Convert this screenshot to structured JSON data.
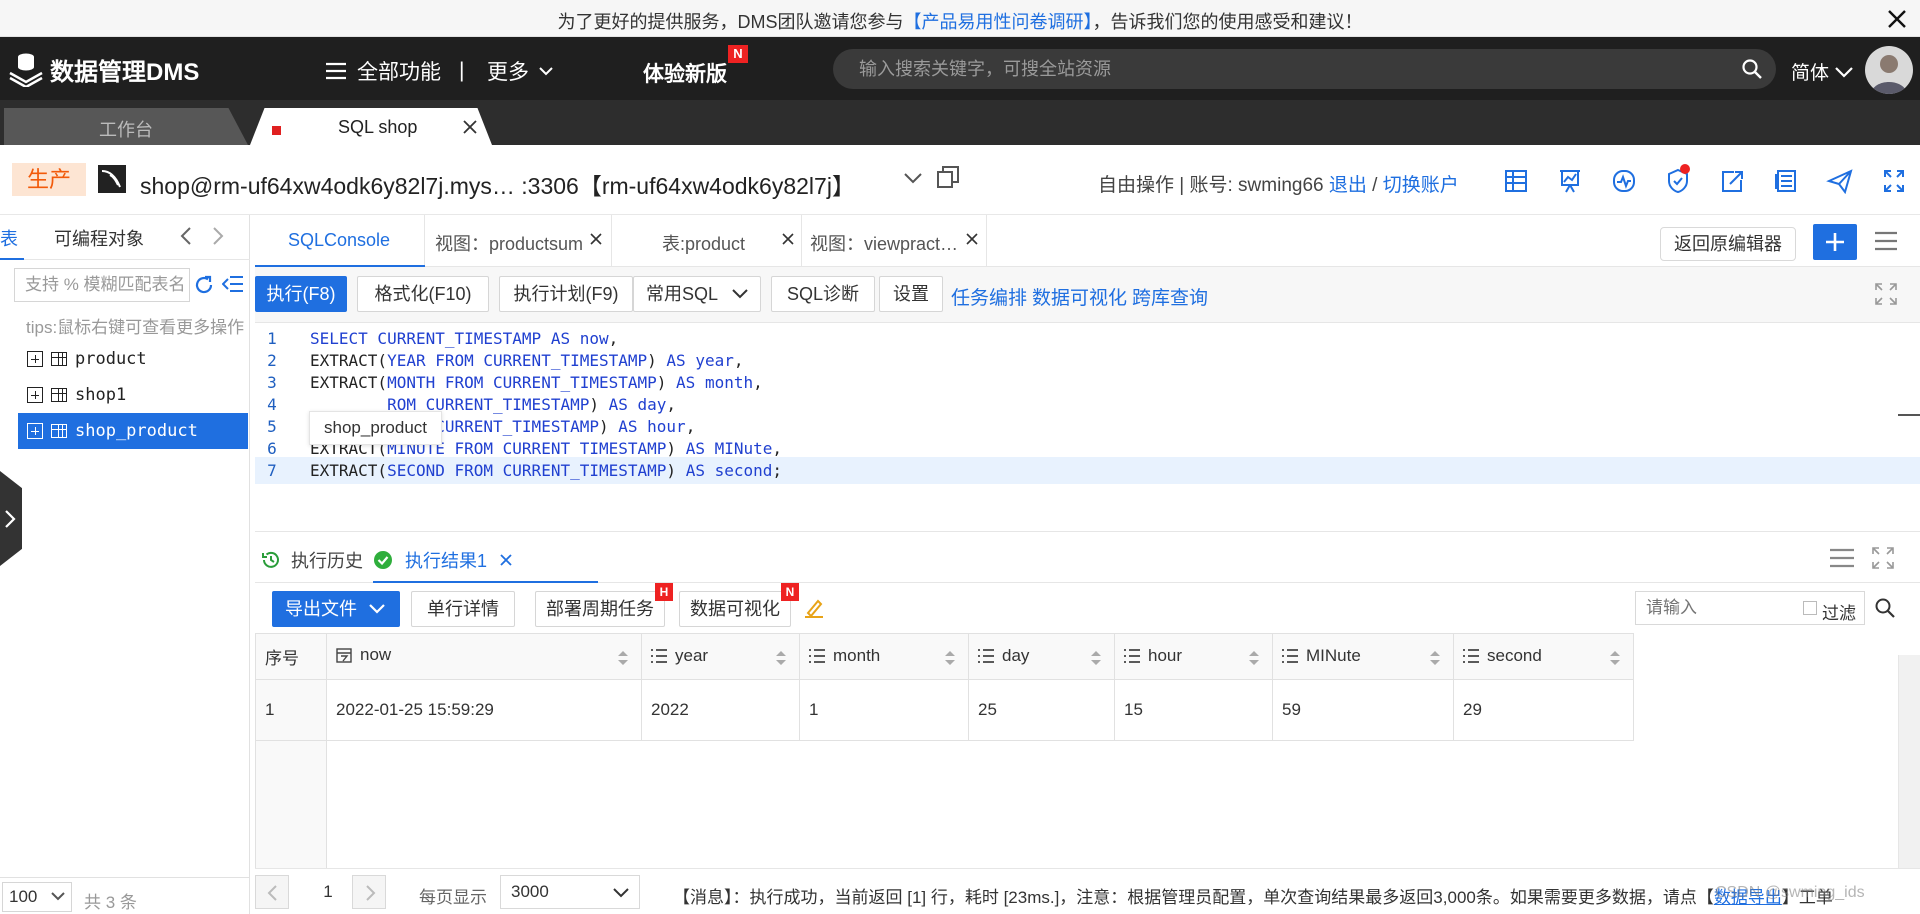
{
  "notice": {
    "before": "为了更好的提供服务，DMS团队邀请您参与",
    "link": "【产品易用性问卷调研】",
    "after": "，告诉我们您的使用感受和建议！"
  },
  "header": {
    "brand": "数据管理DMS",
    "all_functions": "全部功能",
    "separator": "|",
    "more": "更多",
    "new_version": "体验新版",
    "new_badge": "N",
    "search_placeholder": "输入搜索关键字，可搜全站资源",
    "language": "简体"
  },
  "window_tabs": [
    {
      "label": "工作台"
    },
    {
      "label": "SQL shop"
    }
  ],
  "connection": {
    "env": "生产",
    "db": "shop@rm-uf64xw4odk6y82l7j.mys…  :3306【rm-uf64xw4odk6y82l7j】",
    "mode": "自由操作 | 账号: swming66",
    "logout": "退出",
    "slash": "/",
    "switch": "切换账户"
  },
  "left_panel": {
    "tab_tables": "表",
    "tab_programmable": "可编程对象",
    "search_placeholder": "支持 % 模糊匹配表名",
    "tips": "tips:鼠标右键可查看更多操作",
    "tables": [
      "product",
      "shop1",
      "shop_product"
    ],
    "selected": "shop_product",
    "page_size": "100",
    "total": "共 3 条"
  },
  "editor_tabs": [
    {
      "label": "SQLConsole"
    },
    {
      "label": "视图：productsum"
    },
    {
      "label": "表:product"
    },
    {
      "label": "视图：viewpract…"
    }
  ],
  "editor": {
    "back_button": "返回原编辑器",
    "toolbar": {
      "run": "执行(F8)",
      "format": "格式化(F10)",
      "plan": "执行计划(F9)",
      "common_sql": "常用SQL",
      "diagnose": "SQL诊断",
      "settings": "设置",
      "task": "任务编排",
      "visualize": "数据可视化",
      "cross_db": "跨库查询"
    },
    "lines": [
      {
        "num": "1",
        "parts": [
          [
            "kw",
            "SELECT CURRENT_TIMESTAMP AS now"
          ],
          [
            "tx",
            ","
          ]
        ]
      },
      {
        "num": "2",
        "parts": [
          [
            "tx",
            "EXTRACT("
          ],
          [
            "kw",
            "YEAR FROM CURRENT_TIMESTAMP"
          ],
          [
            "tx",
            ") "
          ],
          [
            "kw",
            "AS year"
          ],
          [
            "tx",
            ","
          ]
        ]
      },
      {
        "num": "3",
        "parts": [
          [
            "tx",
            "EXTRACT("
          ],
          [
            "kw",
            "MONTH FROM CURRENT_TIMESTAMP"
          ],
          [
            "tx",
            ") "
          ],
          [
            "kw",
            "AS month"
          ],
          [
            "tx",
            ","
          ]
        ]
      },
      {
        "num": "4",
        "parts": [
          [
            "tx",
            "        "
          ],
          [
            "kw",
            "ROM CURRENT_TIMESTAMP"
          ],
          [
            "tx",
            ") "
          ],
          [
            "kw",
            "AS day"
          ],
          [
            "tx",
            ","
          ]
        ]
      },
      {
        "num": "5",
        "parts": [
          [
            "tx",
            "        "
          ],
          [
            "kw",
            "FROM CURRENT_TIMESTAMP"
          ],
          [
            "tx",
            ") "
          ],
          [
            "kw",
            "AS hour"
          ],
          [
            "tx",
            ","
          ]
        ]
      },
      {
        "num": "6",
        "parts": [
          [
            "tx",
            "EXTRACT("
          ],
          [
            "kw",
            "MINUTE FROM CURRENT_TIMESTAMP"
          ],
          [
            "tx",
            ") "
          ],
          [
            "kw",
            "AS MINute"
          ],
          [
            "tx",
            ","
          ]
        ]
      },
      {
        "num": "7",
        "parts": [
          [
            "tx",
            "EXTRACT("
          ],
          [
            "kw",
            "SECOND FROM CURRENT_TIMESTAMP"
          ],
          [
            "tx",
            ") "
          ],
          [
            "kw",
            "AS second"
          ],
          [
            "tx",
            ";"
          ]
        ]
      }
    ],
    "tooltip": "shop_product"
  },
  "results": {
    "history_tab": "执行历史",
    "result_tab": "执行结果1",
    "export": "导出文件",
    "row_detail": "单行详情",
    "deploy": "部署周期任务",
    "deploy_badge": "H",
    "visualize": "数据可视化",
    "visualize_badge": "N",
    "filter_placeholder": "请输入",
    "filter_label": "过滤",
    "columns": [
      "序号",
      "now",
      "year",
      "month",
      "day",
      "hour",
      "MINute",
      "second"
    ],
    "rows": [
      [
        "1",
        "2022-01-25 15:59:29",
        "2022",
        "1",
        "25",
        "15",
        "59",
        "29"
      ]
    ]
  },
  "status_bar": {
    "page": "1",
    "per_page_label": "每页显示",
    "per_page": "3000",
    "message_pre": "【消息】：执行成功，当前返回 [1] 行，耗时 [23ms.]，注意：根据管理员配置，单次查询结果最多返回3,000条。如果需要更多数据，请点【",
    "message_link": "数据导出",
    "message_post": "】工单"
  },
  "watermark": "CSDN @swming_ids"
}
